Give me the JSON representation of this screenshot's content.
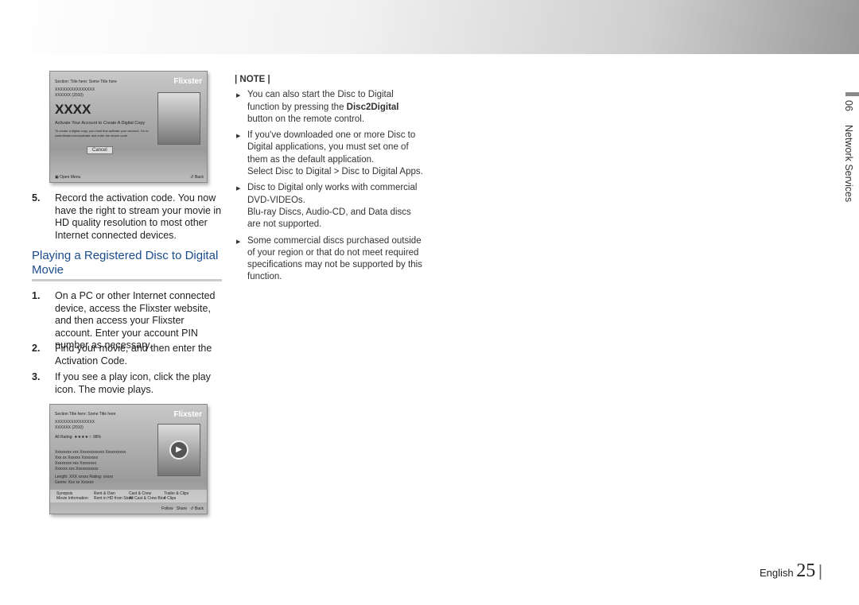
{
  "screen1": {
    "section": "Section: Title here: Some Title here",
    "line1": "XXXXXXXXXXXXXXX",
    "line2": "XXXXXX (2010)",
    "code": "XXXX",
    "activate": "Activate Your Account to Create A Digital Copy",
    "desc1": "To create a digital copy, you must first activate your account. Go to",
    "desc2": "www.flixster.com/activate and enter the above code.",
    "cancel": "Cancel",
    "logo": "Flixster",
    "open_menu": "Open Menu",
    "back": "Back"
  },
  "step5": {
    "num": "5.",
    "text": "Record the activation code. You now have the right to stream your movie in HD quality resolution to most other Internet connected devices."
  },
  "heading": "Playing a Registered Disc to Digital Movie",
  "steps": [
    {
      "num": "1.",
      "text": "On a PC or other Internet connected device, access the Flixster website, and then access your Flixster account. Enter your account PIN number as necessary."
    },
    {
      "num": "2.",
      "text": "Find your movie, and then enter the Activation Code."
    },
    {
      "num": "3.",
      "text": "If you see a play icon, click the play icon. The movie plays."
    }
  ],
  "screen2": {
    "section": "Section Title here: Some Title here",
    "line1": "XXXXXXXXXXXXXXX",
    "line2": "XXXXXX (2010)",
    "rating": "All Rating: ★★★★☆  98%",
    "p1": "Xxxxxxxx xxx Xxxxxxxxxxxx Xxxxxxxxxx",
    "p2": "Xxx xx Xxxxxx Xxxxxxxx",
    "p3": "Xxxxxxxx xxx Xxxxxxxx",
    "p4": "Xxxxxx xxx Xxxxxxxxxxx",
    "length": "Length: XXX xxxxx   Rating: xxxxx",
    "genre": "Genre: Xxx xx Xxxxxx",
    "tabs": [
      {
        "a": "Synopsis",
        "b": "Movie Information"
      },
      {
        "a": "Rent & Own",
        "b": "Rent in HD from Store"
      },
      {
        "a": "Cast & Crew",
        "b": "All Cast & Crew Bios"
      },
      {
        "a": "Trailer & Clips",
        "b": "4 Clips"
      }
    ],
    "follow": "Follow",
    "share": "Share",
    "back": "Back",
    "logo": "Flixster"
  },
  "note": {
    "title": "| NOTE |",
    "items": [
      {
        "pre": "You can also start the Disc to Digital function by pressing the ",
        "bold": "Disc2Digital",
        "post": " button on the remote control."
      },
      {
        "pre": "If you've downloaded one or more Disc to Digital applications, you must set one of them as the default application.",
        "extra": "Select Disc to Digital > Disc to Digital Apps."
      },
      {
        "pre": "Disc to Digital only works with commercial DVD-VIDEOs.",
        "extra": "Blu-ray Discs, Audio-CD, and Data discs are not supported."
      },
      {
        "pre": "Some commercial discs purchased outside of your region or that do not meet required specifications may not be supported by this function."
      }
    ]
  },
  "side": {
    "chapter": "06",
    "section": "Network Services"
  },
  "footer": {
    "lang": "English",
    "page": "25"
  }
}
